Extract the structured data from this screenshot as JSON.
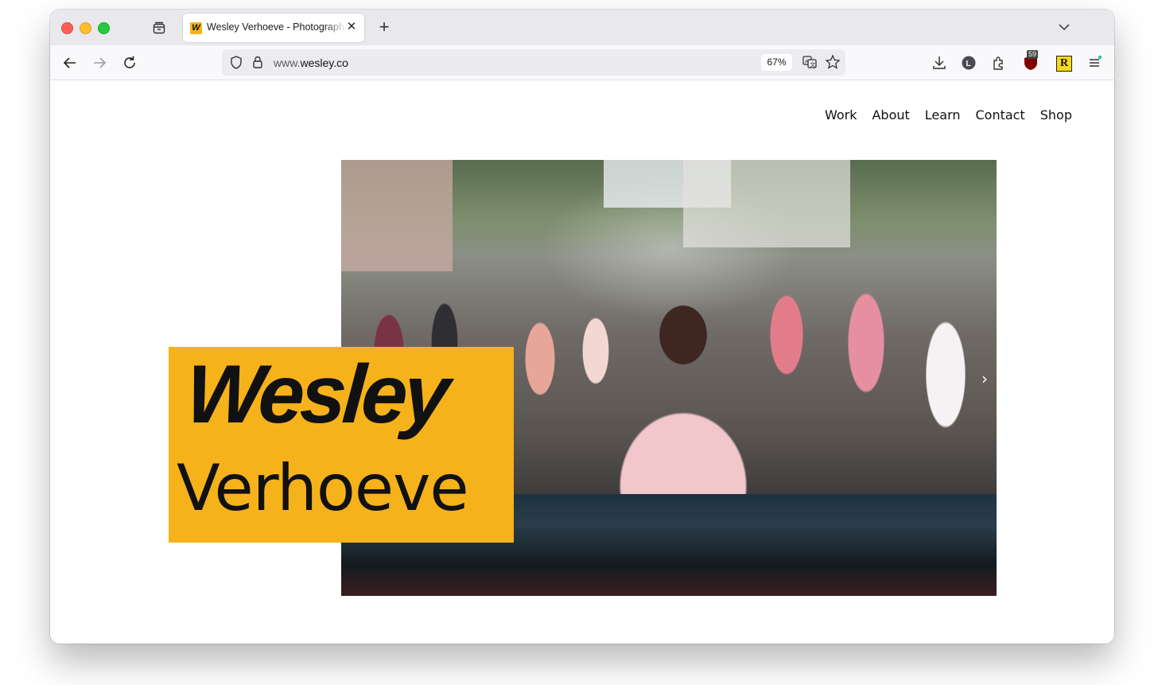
{
  "browser": {
    "tab": {
      "favicon_letter": "W",
      "title": "Wesley Verhoeve - Photographer"
    },
    "url": {
      "prefix": "www.",
      "domain": "wesley.co"
    },
    "zoom": "67%",
    "extension_badge": "59",
    "icons": [
      "tabs-icon",
      "close-icon",
      "plus-icon",
      "chevron-down-icon",
      "back-arrow-icon",
      "forward-arrow-icon",
      "reload-icon",
      "shield-icon",
      "lock-icon",
      "translate-icon",
      "star-icon",
      "download-icon",
      "account-icon",
      "extensions-icon",
      "ublock-icon",
      "r-extension-icon",
      "menu-icon"
    ]
  },
  "site": {
    "nav": [
      "Work",
      "About",
      "Learn",
      "Contact",
      "Shop"
    ],
    "name_first": "Wesley",
    "name_last": "Verhoeve"
  },
  "colors": {
    "accent_yellow": "#f5b21a",
    "text": "#111111"
  }
}
